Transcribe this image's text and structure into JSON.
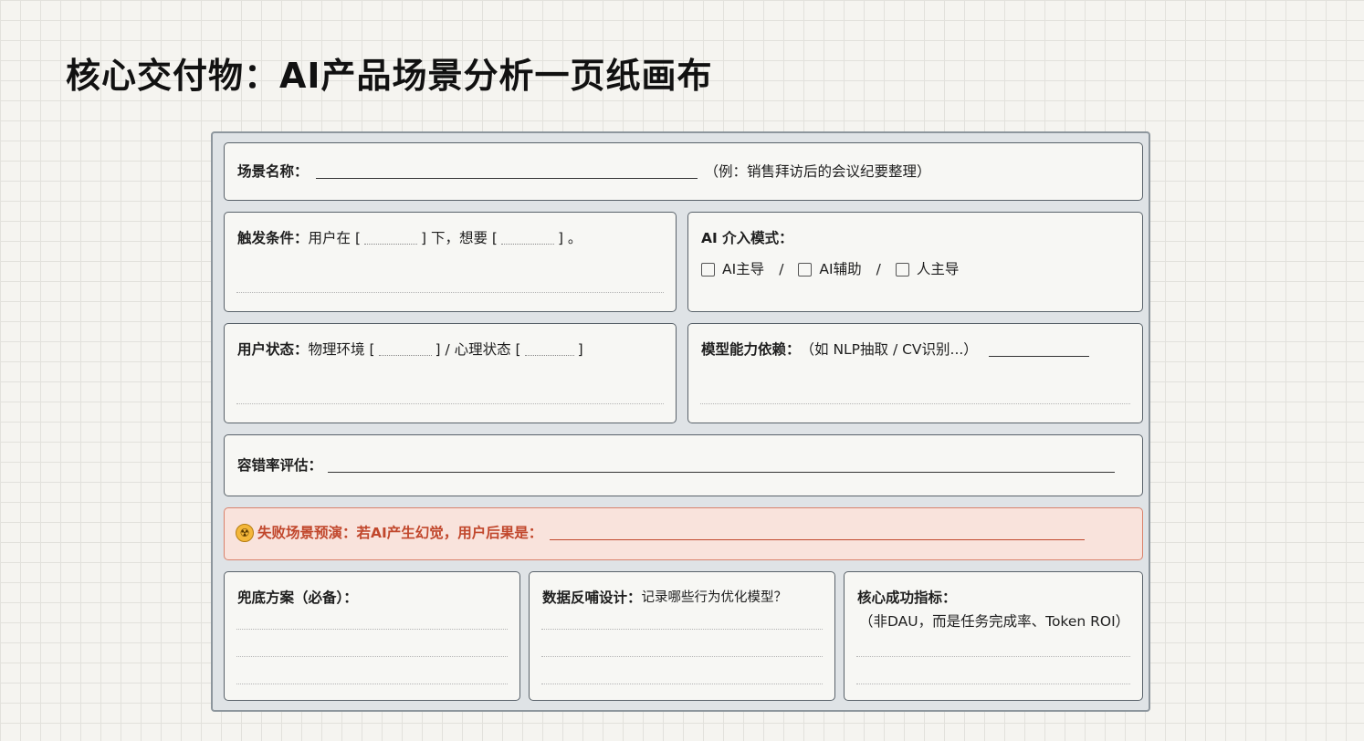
{
  "title": "核心交付物：AI产品场景分析一页纸画布",
  "scene": {
    "label": "场景名称：",
    "example": "（例：销售拜访后的会议纪要整理）"
  },
  "trigger": {
    "label": "触发条件：",
    "t1": "用户在 [",
    "t2": "] 下，想要 [",
    "t3": "] 。"
  },
  "ai_mode": {
    "label": "AI 介入模式：",
    "options": [
      "AI主导",
      "AI辅助",
      "人主导"
    ],
    "separator": "/"
  },
  "user_state": {
    "label": "用户状态：",
    "t1": "物理环境 [",
    "t2": "] / 心理状态 [",
    "t3": "]"
  },
  "model": {
    "label": "模型能力依赖：",
    "hint": "（如 NLP抽取 / CV识别...）"
  },
  "tolerance": {
    "label": "容错率评估："
  },
  "failure": {
    "icon": "radioactive-warning-icon",
    "label": "失败场景预演：若AI产生幻觉，用户后果是："
  },
  "fallback": {
    "label": "兜底方案（必备）："
  },
  "feedback": {
    "label": "数据反哺设计：",
    "hint": "记录哪些行为优化模型？"
  },
  "metric": {
    "label": "核心成功指标：",
    "hint": "（非DAU，而是任务完成率、Token ROI）"
  },
  "colors": {
    "card_border": "#59626a",
    "danger_bg": "#f9e3dc",
    "danger_text": "#c1472c",
    "frame_bg": "#dfe3e6"
  }
}
